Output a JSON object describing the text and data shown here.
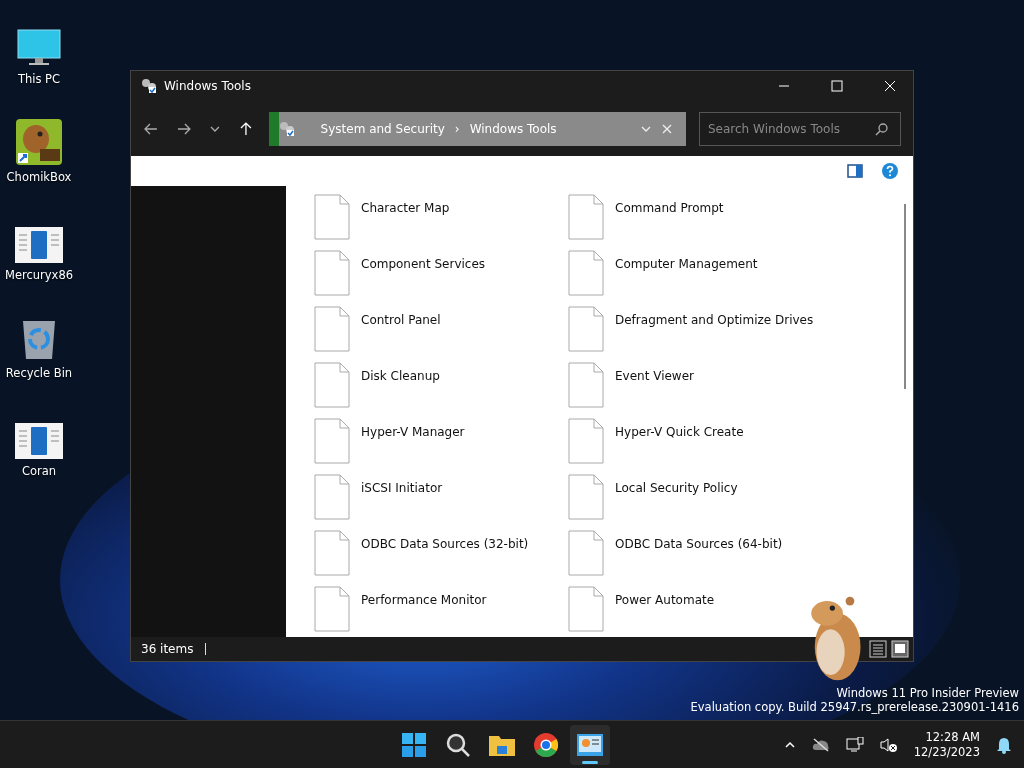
{
  "desktop_icons": [
    {
      "label": "This PC",
      "kind": "monitor"
    },
    {
      "label": "ChomikBox",
      "kind": "app"
    },
    {
      "label": "Mercuryx86",
      "kind": "document"
    },
    {
      "label": "Recycle Bin",
      "kind": "recycle"
    },
    {
      "label": "Coran",
      "kind": "document"
    }
  ],
  "window": {
    "title": "Windows Tools",
    "breadcrumb": [
      "System and Security",
      "Windows Tools"
    ],
    "breadcrumb_separator": "›",
    "search": {
      "placeholder": "Search Windows Tools"
    },
    "items": [
      {
        "label": "Character Map"
      },
      {
        "label": "Command Prompt"
      },
      {
        "label": "Component Services"
      },
      {
        "label": "Computer Management"
      },
      {
        "label": "Control Panel"
      },
      {
        "label": "Defragment and Optimize Drives"
      },
      {
        "label": "Disk Cleanup"
      },
      {
        "label": "Event Viewer"
      },
      {
        "label": "Hyper-V Manager"
      },
      {
        "label": "Hyper-V Quick Create"
      },
      {
        "label": "iSCSI Initiator"
      },
      {
        "label": "Local Security Policy"
      },
      {
        "label": "ODBC Data Sources (32-bit)"
      },
      {
        "label": "ODBC Data Sources (64-bit)"
      },
      {
        "label": "Performance Monitor"
      },
      {
        "label": "Power Automate"
      }
    ],
    "status": "36 items",
    "view_modes": [
      {
        "kind": "details",
        "selected": false
      },
      {
        "kind": "tiles",
        "selected": true
      }
    ]
  },
  "watermark": [
    "Windows 11 Pro Insider Preview",
    "Evaluation copy. Build 25947.rs_prerelease.230901-1416"
  ],
  "taskbar": {
    "apps": [
      {
        "kind": "start",
        "selected": false
      },
      {
        "kind": "search",
        "selected": false
      },
      {
        "kind": "folder",
        "selected": false
      },
      {
        "kind": "browser",
        "selected": false
      },
      {
        "kind": "control",
        "selected": true
      }
    ],
    "time": "12:28 AM",
    "date": "12/23/2023"
  }
}
